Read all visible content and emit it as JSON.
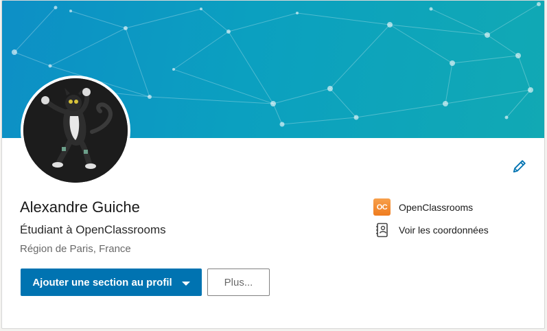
{
  "profile": {
    "name": "Alexandre Guiche",
    "headline": "Étudiant à OpenClassrooms",
    "location": "Région de Paris, France"
  },
  "actions": {
    "add_section_label": "Ajouter une section au profil",
    "more_label": "Plus..."
  },
  "sidebar": {
    "company": {
      "label": "OpenClassrooms",
      "logo_text": "OC",
      "icon": "openclassrooms-logo"
    },
    "contact": {
      "label": "Voir les coordonnées",
      "icon": "contact-book-icon"
    }
  },
  "icons": {
    "edit": "pencil-icon",
    "dropdown": "caret-down-icon"
  },
  "colors": {
    "primary": "#0073b1",
    "banner_start": "#0d8fc6",
    "banner_end": "#11a9b4",
    "oc_orange": "#ef7c1f"
  }
}
